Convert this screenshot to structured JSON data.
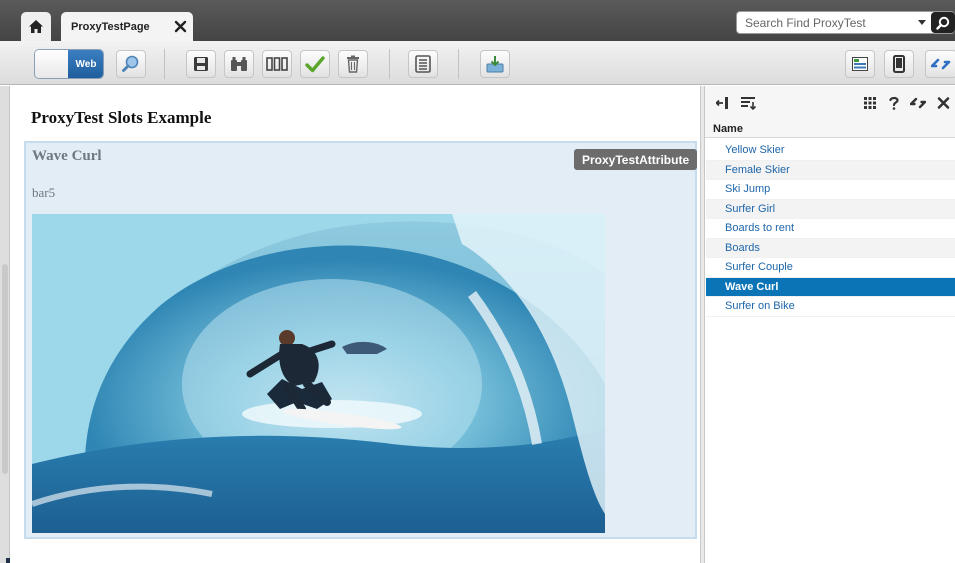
{
  "tabs": {
    "active_tab_label": "ProxyTestPage"
  },
  "search": {
    "placeholder": "Search Find ProxyTest"
  },
  "toolbar": {
    "mode_label": "Web"
  },
  "content": {
    "page_title": "ProxyTest Slots Example",
    "slot": {
      "heading": "Wave Curl",
      "attribute_badge": "ProxyTestAttribute",
      "text": "bar5"
    }
  },
  "panel": {
    "column_header": "Name",
    "items": [
      {
        "label": "Yellow Skier"
      },
      {
        "label": "Female Skier"
      },
      {
        "label": "Ski Jump"
      },
      {
        "label": "Surfer Girl"
      },
      {
        "label": "Boards to rent"
      },
      {
        "label": "Boards"
      },
      {
        "label": "Surfer Couple"
      },
      {
        "label": "Wave Curl"
      },
      {
        "label": "Surfer on Bike"
      }
    ],
    "selected_item": "Wave Curl"
  },
  "colors": {
    "accent": "#0b74b6",
    "link": "#1d66aa",
    "slot_background": "#e2edf6",
    "titlebar": "#4b4b4b"
  },
  "icons": [
    "home-icon",
    "close-icon",
    "search-icon",
    "preview-icon",
    "save-icon",
    "binoculars-icon",
    "layout-icon",
    "checkmark-icon",
    "trash-icon",
    "form-icon",
    "import-icon",
    "panel-layout-icon",
    "mobile-icon",
    "sync-icon",
    "collapse-icon",
    "sort-icon",
    "grid-icon",
    "help-icon"
  ]
}
